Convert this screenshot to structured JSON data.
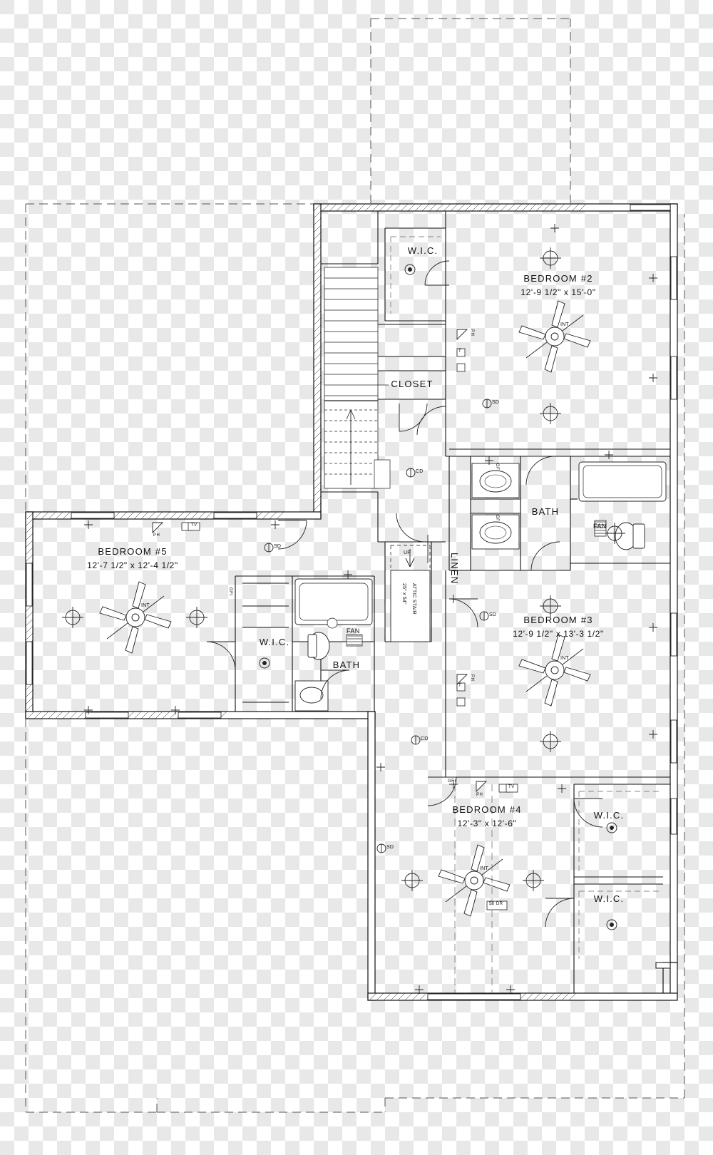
{
  "drawing": {
    "type": "residential-floor-plan",
    "level": "second-floor",
    "rooms": [
      {
        "id": "bedroom2",
        "name": "BEDROOM #2",
        "dim": "12'-9 1/2\" x 15'-0\""
      },
      {
        "id": "bedroom3",
        "name": "BEDROOM #3",
        "dim": "12'-9 1/2\" x 13'-3 1/2\""
      },
      {
        "id": "bedroom4",
        "name": "BEDROOM #4",
        "dim": "12'-3\" x 12'-6\""
      },
      {
        "id": "bedroom5",
        "name": "BEDROOM #5",
        "dim": "12'-7 1/2\" x 12'-4 1/2\""
      }
    ],
    "spaces": [
      {
        "id": "wic-top",
        "name": "W.I.C."
      },
      {
        "id": "closet-top",
        "name": "CLOSET"
      },
      {
        "id": "bath-upper",
        "name": "BATH"
      },
      {
        "id": "linen",
        "name": "LINEN"
      },
      {
        "id": "bath-left",
        "name": "BATH"
      },
      {
        "id": "wic-left",
        "name": "W.I.C."
      },
      {
        "id": "wic-br4-upper",
        "name": "W.I.C."
      },
      {
        "id": "wic-br4-lower",
        "name": "W.I.C."
      }
    ],
    "annotations": [
      {
        "id": "attic-stair",
        "line1": "25\" x 54\"",
        "line2": "ATTIC STAIR",
        "arrow": "UP"
      },
      {
        "id": "attic-stair-up",
        "text": "UP"
      },
      {
        "id": "fan-note-bath-upper",
        "text": "FAN"
      },
      {
        "id": "fan-note-bath-left",
        "text": "FAN"
      },
      {
        "id": "dryer-note",
        "text": "50 DR"
      }
    ],
    "symbols": [
      {
        "id": "smoke-detector",
        "label": "SD"
      },
      {
        "id": "carbon-detector",
        "label": "CD"
      },
      {
        "id": "phone-jack",
        "label": "PH"
      },
      {
        "id": "tv-jack",
        "label": "TV"
      },
      {
        "id": "thermostat",
        "label": "T"
      },
      {
        "id": "ceiling-fan-light",
        "label": "INT"
      },
      {
        "id": "gfi-outlet",
        "label": "GFI"
      }
    ],
    "fan_labels": [
      "INT",
      "INT",
      "INT",
      "INT"
    ]
  }
}
